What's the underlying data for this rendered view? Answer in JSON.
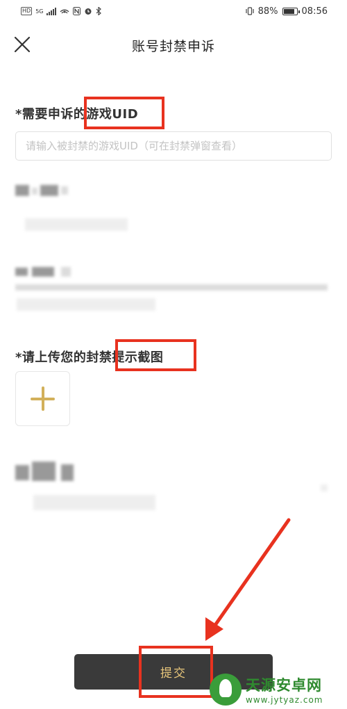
{
  "status_bar": {
    "left_chip": "HD",
    "network": "5G",
    "battery": "88%",
    "battery_level": 0.88,
    "time": "08:56"
  },
  "nav": {
    "title": "账号封禁申诉"
  },
  "form": {
    "uid_label": "*需要申诉的游戏UID",
    "uid_placeholder": "请输入被封禁的游戏UID（可在封禁弹窗查看）",
    "uid_value": "",
    "screenshot_label": "*请上传您的封禁提示截图"
  },
  "footer": {
    "submit_label": "提交"
  },
  "watermark": {
    "name": "天源安卓网",
    "url": "www.jytyaz.com"
  },
  "colors": {
    "highlight": "#e8321f",
    "accent_gold": "#d2b05a",
    "submit_bg": "#3a3a3a",
    "submit_text": "#e9c77b"
  }
}
